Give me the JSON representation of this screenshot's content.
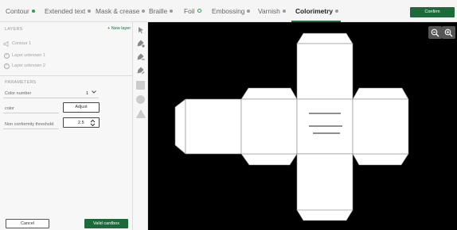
{
  "tabs": [
    {
      "label": "Contour",
      "status": "done"
    },
    {
      "label": "Extended text",
      "status": "none"
    },
    {
      "label": "Mask & crease",
      "status": "none"
    },
    {
      "label": "Braille",
      "status": "none"
    },
    {
      "label": "Foil",
      "status": "pending"
    },
    {
      "label": "Embossing",
      "status": "none"
    },
    {
      "label": "Varnish",
      "status": "none"
    },
    {
      "label": "Colorimetry",
      "status": "none",
      "active": true
    }
  ],
  "confirm_label": "Confirm",
  "layers": {
    "title": "LAYERS",
    "new_layer_label": "+ New layer",
    "items": [
      {
        "label": "Contour 1",
        "icon": "megaphone-icon"
      },
      {
        "label": "Layer unknown 1",
        "icon": "question-icon"
      },
      {
        "label": "Layer unknown 2",
        "icon": "question-icon"
      }
    ]
  },
  "parameters": {
    "title": "PARAMETERS",
    "color_number_label": "Color number",
    "color_number_value": "1",
    "color_label": "color",
    "adjust_label": "Adjust",
    "threshold_label": "Non conformity threshold",
    "threshold_value": "2.5"
  },
  "buttons": {
    "cancel": "Cancel",
    "valid": "Valid cardbox"
  },
  "tools": [
    "pointer-icon",
    "pen-add-icon",
    "pen-remove-icon",
    "pen-edit-icon",
    "rectangle-icon",
    "circle-icon",
    "triangle-icon"
  ],
  "colors": {
    "accent": "#1b6b3a",
    "done_dot": "#2e9e4e",
    "canvas_bg": "#000000"
  }
}
